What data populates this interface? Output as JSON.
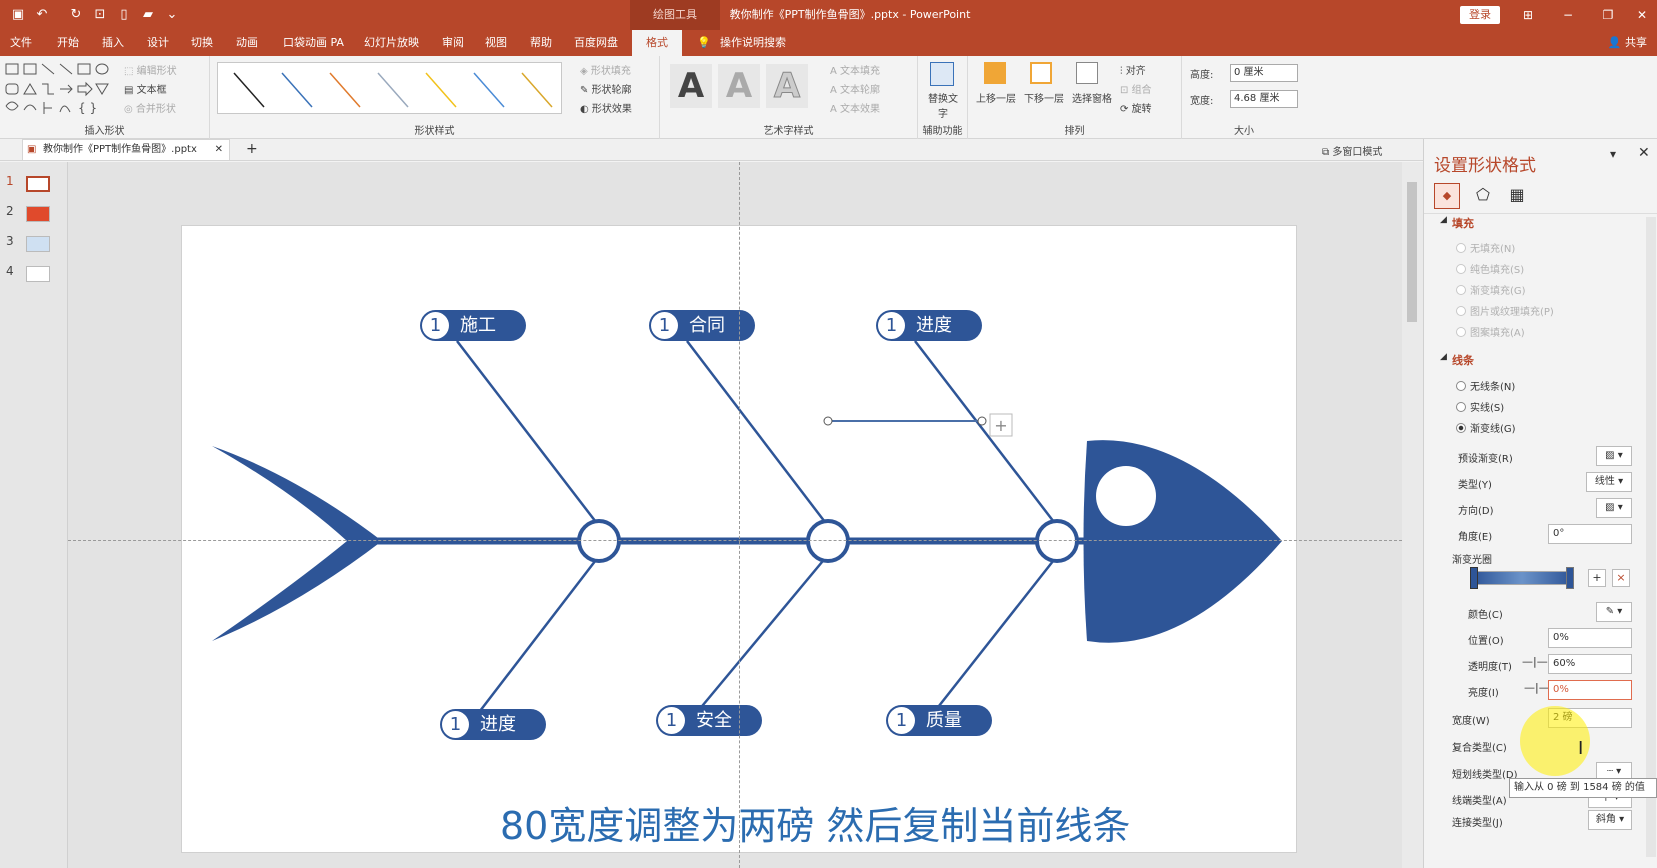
{
  "titlebar": {
    "context_tab": "绘图工具",
    "doc_title": "教你制作《PPT制作鱼骨图》.pptx - PowerPoint",
    "login": "登录"
  },
  "tabs": [
    "文件",
    "开始",
    "插入",
    "设计",
    "切换",
    "动画",
    "口袋动画 PA",
    "幻灯片放映",
    "审阅",
    "视图",
    "帮助",
    "百度网盘",
    "格式",
    "操作说明搜索"
  ],
  "share": "共享",
  "ribbon": {
    "insert_shapes": {
      "label": "插入形状",
      "edit_shape": "编辑形状",
      "textbox": "文本框",
      "merge_shapes": "合并形状"
    },
    "shape_styles": {
      "label": "形状样式",
      "fill": "形状填充",
      "outline": "形状轮廓",
      "effects": "形状效果"
    },
    "wordart": {
      "label": "艺术字样式",
      "letter": "A",
      "text_fill": "文本填充",
      "text_outline": "文本轮廓",
      "text_effects": "文本效果"
    },
    "accessibility": {
      "label": "辅助功能",
      "alt_text": "替换文字"
    },
    "arrange": {
      "label": "排列",
      "bring_forward": "上移一层",
      "send_backward": "下移一层",
      "selection_pane": "选择窗格",
      "align": "对齐",
      "group": "组合",
      "rotate": "旋转"
    },
    "size": {
      "label": "大小",
      "height_label": "高度:",
      "height": "0 厘米",
      "width_label": "宽度:",
      "width": "4.68 厘米"
    }
  },
  "doc_tab": {
    "name": "教你制作《PPT制作鱼骨图》.pptx",
    "multi_window": "多窗口模式"
  },
  "slides": [
    "1",
    "2",
    "3",
    "4"
  ],
  "slide": {
    "top_labels": [
      {
        "num": "1",
        "text": "施工"
      },
      {
        "num": "1",
        "text": "合同"
      },
      {
        "num": "1",
        "text": "进度"
      }
    ],
    "bottom_labels": [
      {
        "num": "1",
        "text": "进度"
      },
      {
        "num": "1",
        "text": "安全"
      },
      {
        "num": "1",
        "text": "质量"
      }
    ],
    "caption": "80宽度调整为两磅 然后复制当前线条",
    "plus": "+"
  },
  "panel": {
    "title": "设置形状格式",
    "fill_section": "填充",
    "fill_options": [
      "无填充(N)",
      "纯色填充(S)",
      "渐变填充(G)",
      "图片或纹理填充(P)",
      "图案填充(A)"
    ],
    "line_section": "线条",
    "line_options": [
      "无线条(N)",
      "实线(S)",
      "渐变线(G)"
    ],
    "preset_gradient": "预设渐变(R)",
    "type_label": "类型(Y)",
    "type_value": "线性",
    "direction_label": "方向(D)",
    "angle_label": "角度(E)",
    "angle_value": "0°",
    "gradient_stops": "渐变光圈",
    "color_label": "颜色(C)",
    "position_label": "位置(O)",
    "position_value": "0%",
    "transparency_label": "透明度(T)",
    "transparency_value": "60%",
    "brightness_label": "亮度(I)",
    "brightness_value": "0%",
    "width_label": "宽度(W)",
    "width_value": "2 磅",
    "compound_label": "复合类型(C)",
    "dash_label": "短划线类型(D)",
    "cap_label": "线端类型(A)",
    "cap_value": "平",
    "join_label": "连接类型(J)",
    "join_value": "斜角",
    "tooltip": "输入从 0 磅 到 1584 磅 的值"
  },
  "colors": {
    "accent": "#b7472a",
    "fish": "#2e5597"
  }
}
